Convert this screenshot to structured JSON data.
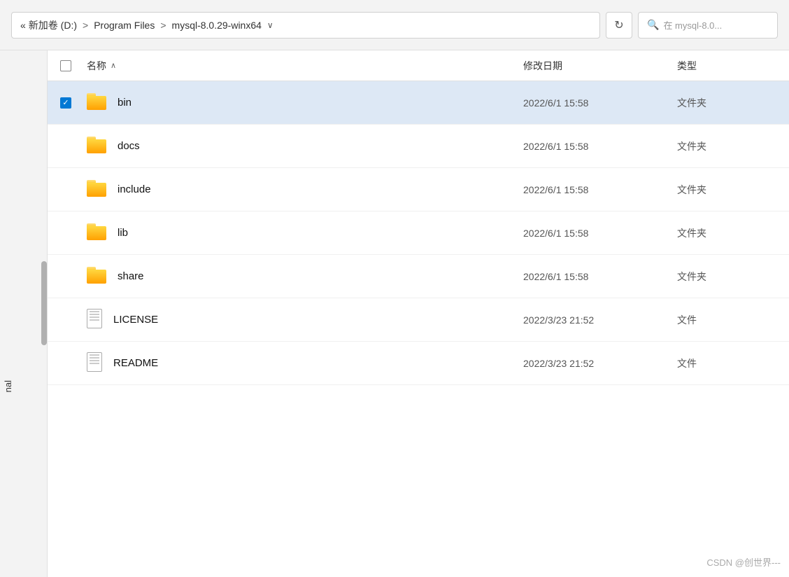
{
  "addressBar": {
    "breadcrumb": {
      "prefix": "«",
      "drive": "新加卷 (D:)",
      "sep1": ">",
      "folder1": "Program Files",
      "sep2": ">",
      "folder2": "mysql-8.0.29-winx64"
    },
    "dropdownLabel": "∨",
    "refreshLabel": "↻",
    "searchPlaceholder": "在 mysql-8.0..."
  },
  "columns": {
    "name": "名称",
    "sortArrow": "∧",
    "date": "修改日期",
    "type": "类型"
  },
  "files": [
    {
      "name": "bin",
      "date": "2022/6/1 15:58",
      "type": "文件夹",
      "kind": "folder",
      "selected": true,
      "checked": true
    },
    {
      "name": "docs",
      "date": "2022/6/1 15:58",
      "type": "文件夹",
      "kind": "folder",
      "selected": false,
      "checked": false
    },
    {
      "name": "include",
      "date": "2022/6/1 15:58",
      "type": "文件夹",
      "kind": "folder",
      "selected": false,
      "checked": false
    },
    {
      "name": "lib",
      "date": "2022/6/1 15:58",
      "type": "文件夹",
      "kind": "folder",
      "selected": false,
      "checked": false
    },
    {
      "name": "share",
      "date": "2022/6/1 15:58",
      "type": "文件夹",
      "kind": "folder",
      "selected": false,
      "checked": false
    },
    {
      "name": "LICENSE",
      "date": "2022/3/23 21:52",
      "type": "文件",
      "kind": "file",
      "selected": false,
      "checked": false
    },
    {
      "name": "README",
      "date": "2022/3/23 21:52",
      "type": "文件",
      "kind": "file",
      "selected": false,
      "checked": false
    }
  ],
  "sidebarLabel": "nal",
  "watermark": "CSDN @创世界---"
}
